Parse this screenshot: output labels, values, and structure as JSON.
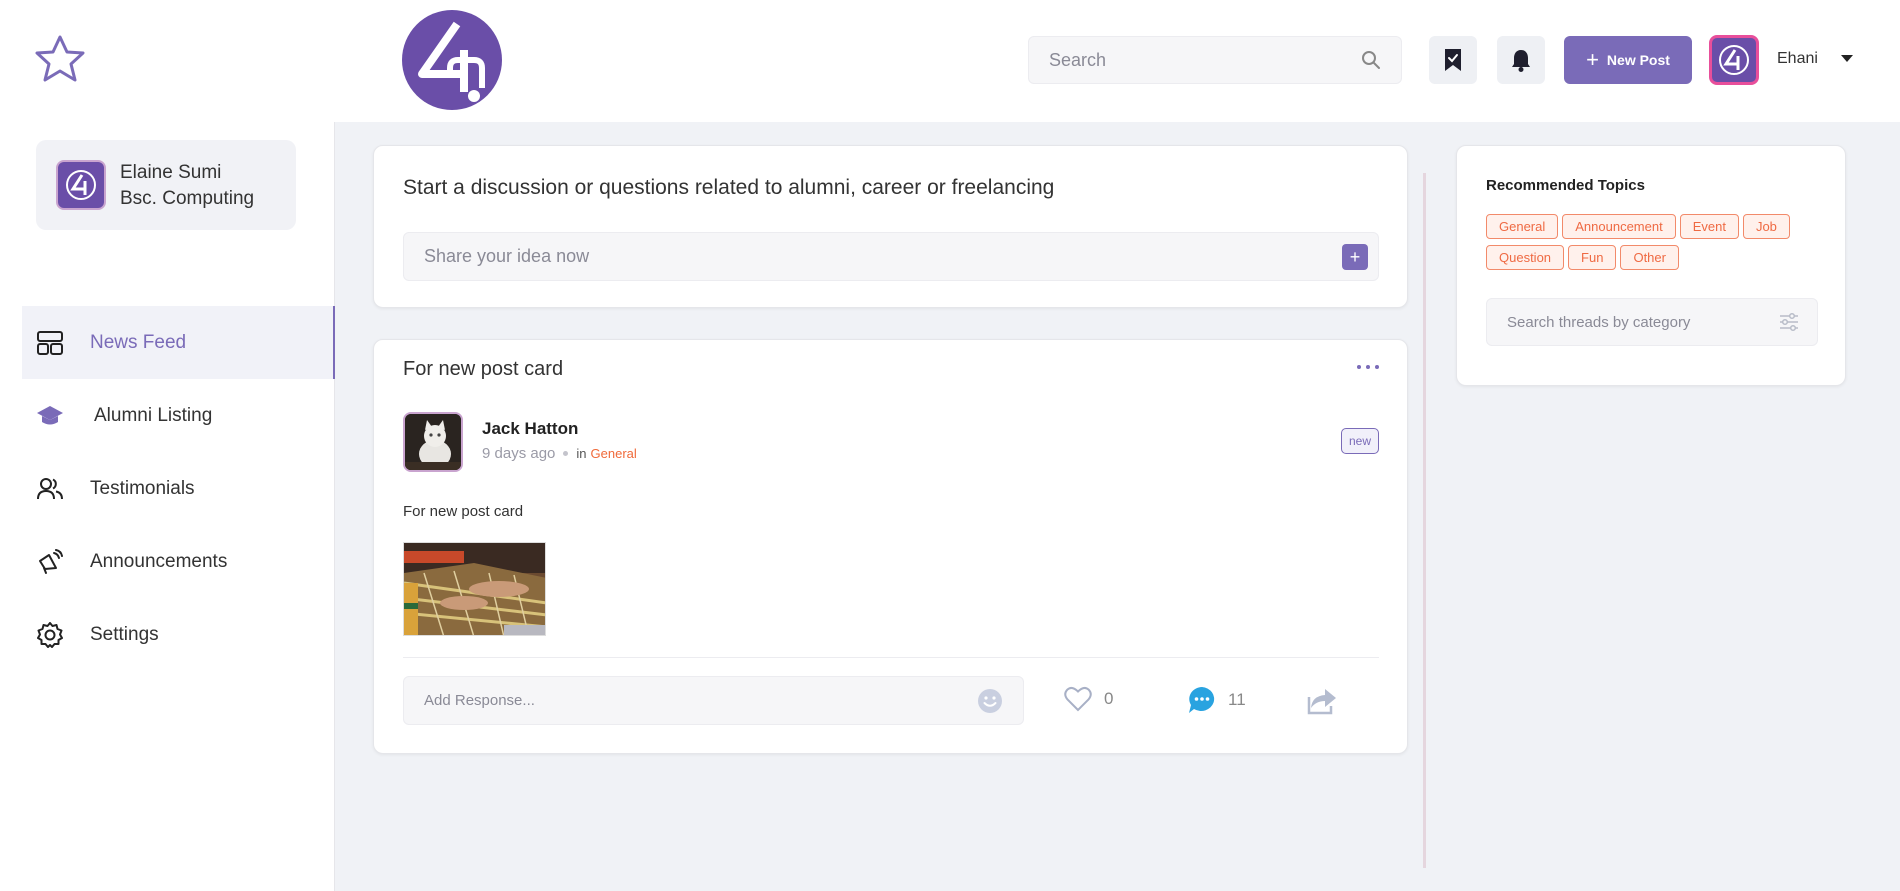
{
  "header": {
    "search_placeholder": "Search",
    "new_post_label": "New Post",
    "new_post_icon": "plus-icon",
    "user_name": "Ehani"
  },
  "sidebar": {
    "profile": {
      "name": "Elaine Sumi",
      "course": "Bsc. Computing"
    },
    "items": [
      {
        "label": "News Feed",
        "icon": "news-feed-icon",
        "active": true
      },
      {
        "label": "Alumni Listing",
        "icon": "graduation-cap-icon",
        "active": false
      },
      {
        "label": "Testimonials",
        "icon": "people-icon",
        "active": false
      },
      {
        "label": "Announcements",
        "icon": "megaphone-icon",
        "active": false
      },
      {
        "label": "Settings",
        "icon": "gear-icon",
        "active": false
      }
    ]
  },
  "composer": {
    "title": "Start a discussion or questions related to alumni, career or freelancing",
    "placeholder": "Share your idea now",
    "add_label": "+"
  },
  "post": {
    "title": "For new post card",
    "author": "Jack Hatton",
    "time": "9 days ago",
    "in_label": "in",
    "category": "General",
    "badge": "new",
    "body": "For new post card",
    "response_placeholder": "Add Response...",
    "likes": "0",
    "comments": "11"
  },
  "recommended": {
    "title": "Recommended Topics",
    "tags": [
      "General",
      "Announcement",
      "Event",
      "Job",
      "Question",
      "Fun",
      "Other"
    ],
    "search_placeholder": "Search threads by category"
  },
  "colors": {
    "accent": "#7a6bb8",
    "tag": "#ef6a43",
    "comment": "#29a3e0",
    "avatar_border": "#e84f9b"
  }
}
